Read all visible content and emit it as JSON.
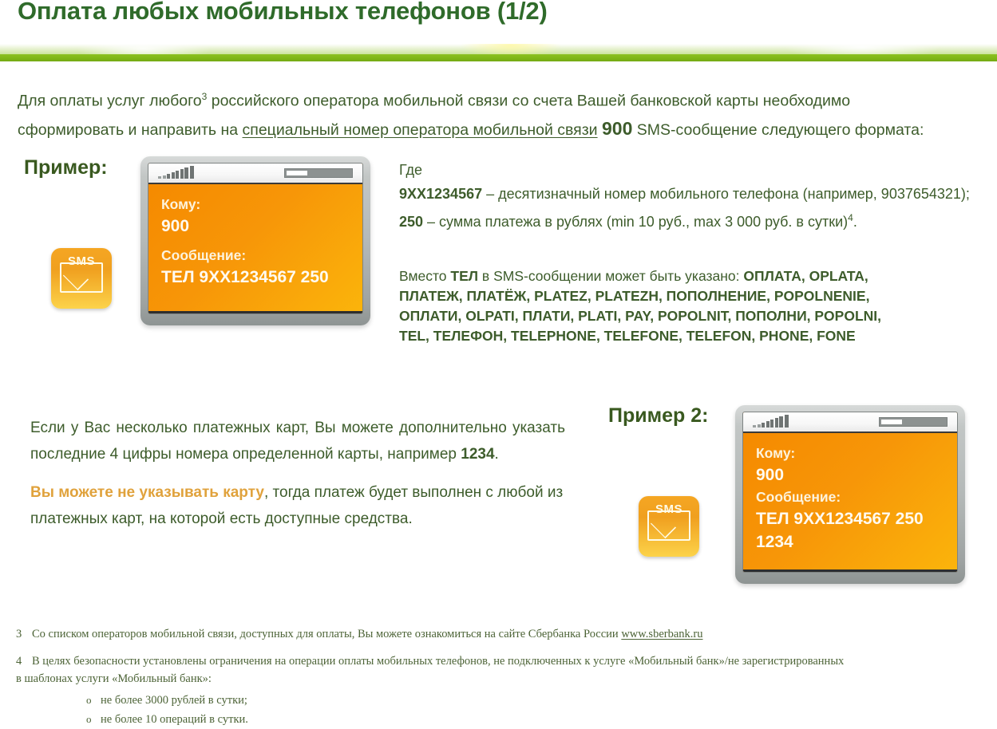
{
  "header": {
    "title": "Оплата любых мобильных телефонов (1/2)",
    "accent_green": "#2f6b2a",
    "bar_green": "#7fb717"
  },
  "intro": {
    "line1_a": "Для оплаты услуг любого",
    "line1_sup": "3",
    "line1_b": " российского оператора мобильной связи со счета Вашей банковской карты необходимо",
    "line2_a": "сформировать и направить на ",
    "line2_link": "специальный номер оператора мобильной связи",
    "line2_number": "900",
    "line2_b": " SMS-сообщение следующего формата:"
  },
  "example1": {
    "label": "Пример:",
    "sms_icon_text": "SMS",
    "phone": {
      "to_label": "Кому:",
      "to_value": "900",
      "message_label": "Сообщение:",
      "message_value": "ТЕЛ 9ХХ1234567 250"
    }
  },
  "example2": {
    "label": "Пример 2:",
    "sms_icon_text": "SMS",
    "phone": {
      "to_label": "Кому:",
      "to_value": "900",
      "message_label": "Сообщение:",
      "message_value": "ТЕЛ 9ХХ1234567 250",
      "message_value2": "1234"
    }
  },
  "explain": {
    "gde": "Где",
    "number_token": "9XX1234567",
    "number_desc": " – десятизначный номер мобильного телефона (например, 9037654321);",
    "amount_token": "250",
    "amount_desc_a": " – сумма платежа в рублях (min 10 руб., max 3 000 руб. в сутки)",
    "amount_sup": "4",
    "amount_desc_b": "."
  },
  "keywords": {
    "intro_a": "Вместо ",
    "intro_token": "ТЕЛ",
    "intro_b": " в SMS-сообщении может быть указано: ",
    "line1_tail": "ОПЛАТА, OPLATA,",
    "line2": "ПЛАТЕЖ, ПЛАТЁЖ, PLATEZ, PLATEZH, ПОПОЛНЕНИЕ, POPOLNENIE,",
    "line3": "ОПЛАТИ, OLPATI, ПЛАТИ, PLATI, PAY, POPOLNIT, ПОПОЛНИ, POPOLNI,",
    "line4": "TEL, ТЕЛЕФОН, TELEPHONE, TELEFONE, TELEFON, PHONE, FONE"
  },
  "lower_left": {
    "p1": "Если у Вас несколько платежных карт, Вы можете дополнительно указать последние 4 цифры номера определенной карты, например ",
    "p1_bold": "1234",
    "p1_end": ".",
    "p2_highlight": "Вы можете не указывать карту",
    "p2_rest": ", тогда платеж будет выполнен с любой из платежных карт, на которой есть доступные средства.",
    "highlight_color": "#e0a23c"
  },
  "footnotes": {
    "fn3_num": "3",
    "fn3_text": "Со списком операторов мобильной связи, доступных для оплаты, Вы можете ознакомиться на сайте Сбербанка России ",
    "fn3_link": "www.sberbank.ru",
    "fn4_num": "4",
    "fn4_text_1": "В целях безопасности установлены ограничения на операции оплаты мобильных телефонов, не подключенных к услуге «Мобильный банк»/не зарегистрированных",
    "fn4_text_2": "в шаблонах услуги «Мобильный банк»:",
    "fn4_bullet_marker": "o",
    "fn4_bullet_1": "не более 3000 рублей в сутки;",
    "fn4_bullet_2": "не более 10 операций в сутки."
  }
}
